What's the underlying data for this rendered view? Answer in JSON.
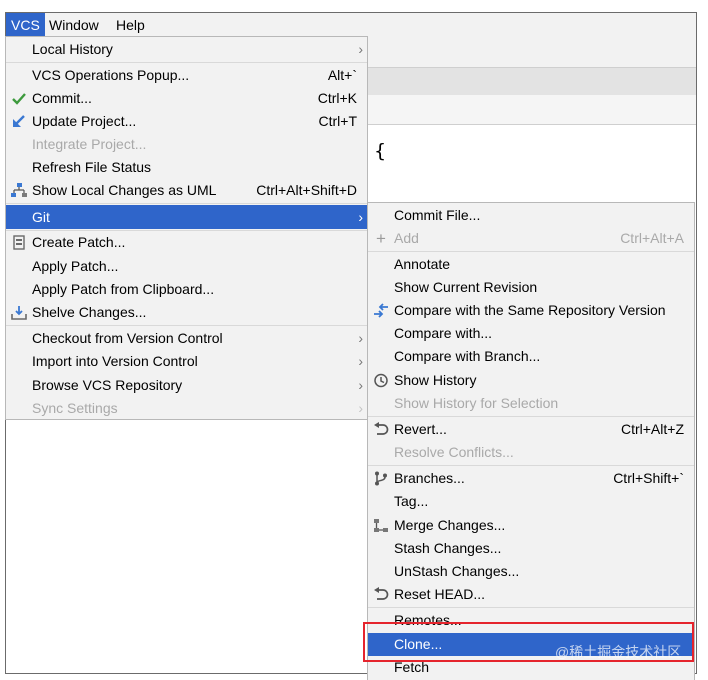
{
  "menubar": {
    "items": [
      "VCS",
      "Window",
      "Help"
    ]
  },
  "editor": {
    "code_fragment": "s) {"
  },
  "vcs_menu": {
    "items": [
      {
        "label": "Local History",
        "shortcut": "",
        "submenu": true,
        "disabled": false
      },
      {
        "label": "VCS Operations Popup...",
        "shortcut": "Alt+`",
        "submenu": false,
        "disabled": false
      },
      {
        "label": "Commit...",
        "shortcut": "Ctrl+K",
        "submenu": false,
        "disabled": false,
        "icon": "checkmark-icon"
      },
      {
        "label": "Update Project...",
        "shortcut": "Ctrl+T",
        "submenu": false,
        "disabled": false,
        "icon": "update-arrow-icon"
      },
      {
        "label": "Integrate Project...",
        "shortcut": "",
        "submenu": false,
        "disabled": true
      },
      {
        "label": "Refresh File Status",
        "shortcut": "",
        "submenu": false,
        "disabled": false
      },
      {
        "label": "Show Local Changes as UML",
        "shortcut": "Ctrl+Alt+Shift+D",
        "submenu": false,
        "disabled": false,
        "icon": "uml-diagram-icon"
      },
      {
        "label": "Git",
        "shortcut": "",
        "submenu": true,
        "disabled": false,
        "selected": true
      },
      {
        "label": "Create Patch...",
        "shortcut": "",
        "submenu": false,
        "disabled": false,
        "icon": "patch-icon"
      },
      {
        "label": "Apply Patch...",
        "shortcut": "",
        "submenu": false,
        "disabled": false
      },
      {
        "label": "Apply Patch from Clipboard...",
        "shortcut": "",
        "submenu": false,
        "disabled": false
      },
      {
        "label": "Shelve Changes...",
        "shortcut": "",
        "submenu": false,
        "disabled": false,
        "icon": "shelve-icon"
      },
      {
        "label": "Checkout from Version Control",
        "shortcut": "",
        "submenu": true,
        "disabled": false
      },
      {
        "label": "Import into Version Control",
        "shortcut": "",
        "submenu": true,
        "disabled": false
      },
      {
        "label": "Browse VCS Repository",
        "shortcut": "",
        "submenu": true,
        "disabled": false
      },
      {
        "label": "Sync Settings",
        "shortcut": "",
        "submenu": true,
        "disabled": true
      }
    ]
  },
  "git_menu": {
    "items": [
      {
        "label": "Commit File...",
        "shortcut": "",
        "disabled": false
      },
      {
        "label": "Add",
        "shortcut": "Ctrl+Alt+A",
        "disabled": true,
        "icon": "plus-icon"
      },
      {
        "label": "Annotate",
        "shortcut": "",
        "disabled": false
      },
      {
        "label": "Show Current Revision",
        "shortcut": "",
        "disabled": false
      },
      {
        "label": "Compare with the Same Repository Version",
        "shortcut": "",
        "disabled": false,
        "icon": "compare-arrows-icon"
      },
      {
        "label": "Compare with...",
        "shortcut": "",
        "disabled": false
      },
      {
        "label": "Compare with Branch...",
        "shortcut": "",
        "disabled": false
      },
      {
        "label": "Show History",
        "shortcut": "",
        "disabled": false,
        "icon": "clock-icon"
      },
      {
        "label": "Show History for Selection",
        "shortcut": "",
        "disabled": true
      },
      {
        "label": "Revert...",
        "shortcut": "Ctrl+Alt+Z",
        "disabled": false,
        "icon": "revert-icon"
      },
      {
        "label": "Resolve Conflicts...",
        "shortcut": "",
        "disabled": true
      },
      {
        "label": "Branches...",
        "shortcut": "Ctrl+Shift+`",
        "disabled": false,
        "icon": "branch-icon"
      },
      {
        "label": "Tag...",
        "shortcut": "",
        "disabled": false
      },
      {
        "label": "Merge Changes...",
        "shortcut": "",
        "disabled": false,
        "icon": "merge-icon"
      },
      {
        "label": "Stash Changes...",
        "shortcut": "",
        "disabled": false
      },
      {
        "label": "UnStash Changes...",
        "shortcut": "",
        "disabled": false
      },
      {
        "label": "Reset HEAD...",
        "shortcut": "",
        "disabled": false,
        "icon": "revert-icon"
      },
      {
        "label": "Remotes...",
        "shortcut": "",
        "disabled": false
      },
      {
        "label": "Clone...",
        "shortcut": "",
        "disabled": false,
        "selected": true
      },
      {
        "label": "Fetch",
        "shortcut": "",
        "disabled": false
      }
    ]
  },
  "watermark": "@稀土掘金技术社区",
  "colors": {
    "selection": "#2f65ca",
    "menu_bg": "#f2f2f2",
    "highlight_box": "#e5242d",
    "disabled_text": "#a9a9a9"
  }
}
